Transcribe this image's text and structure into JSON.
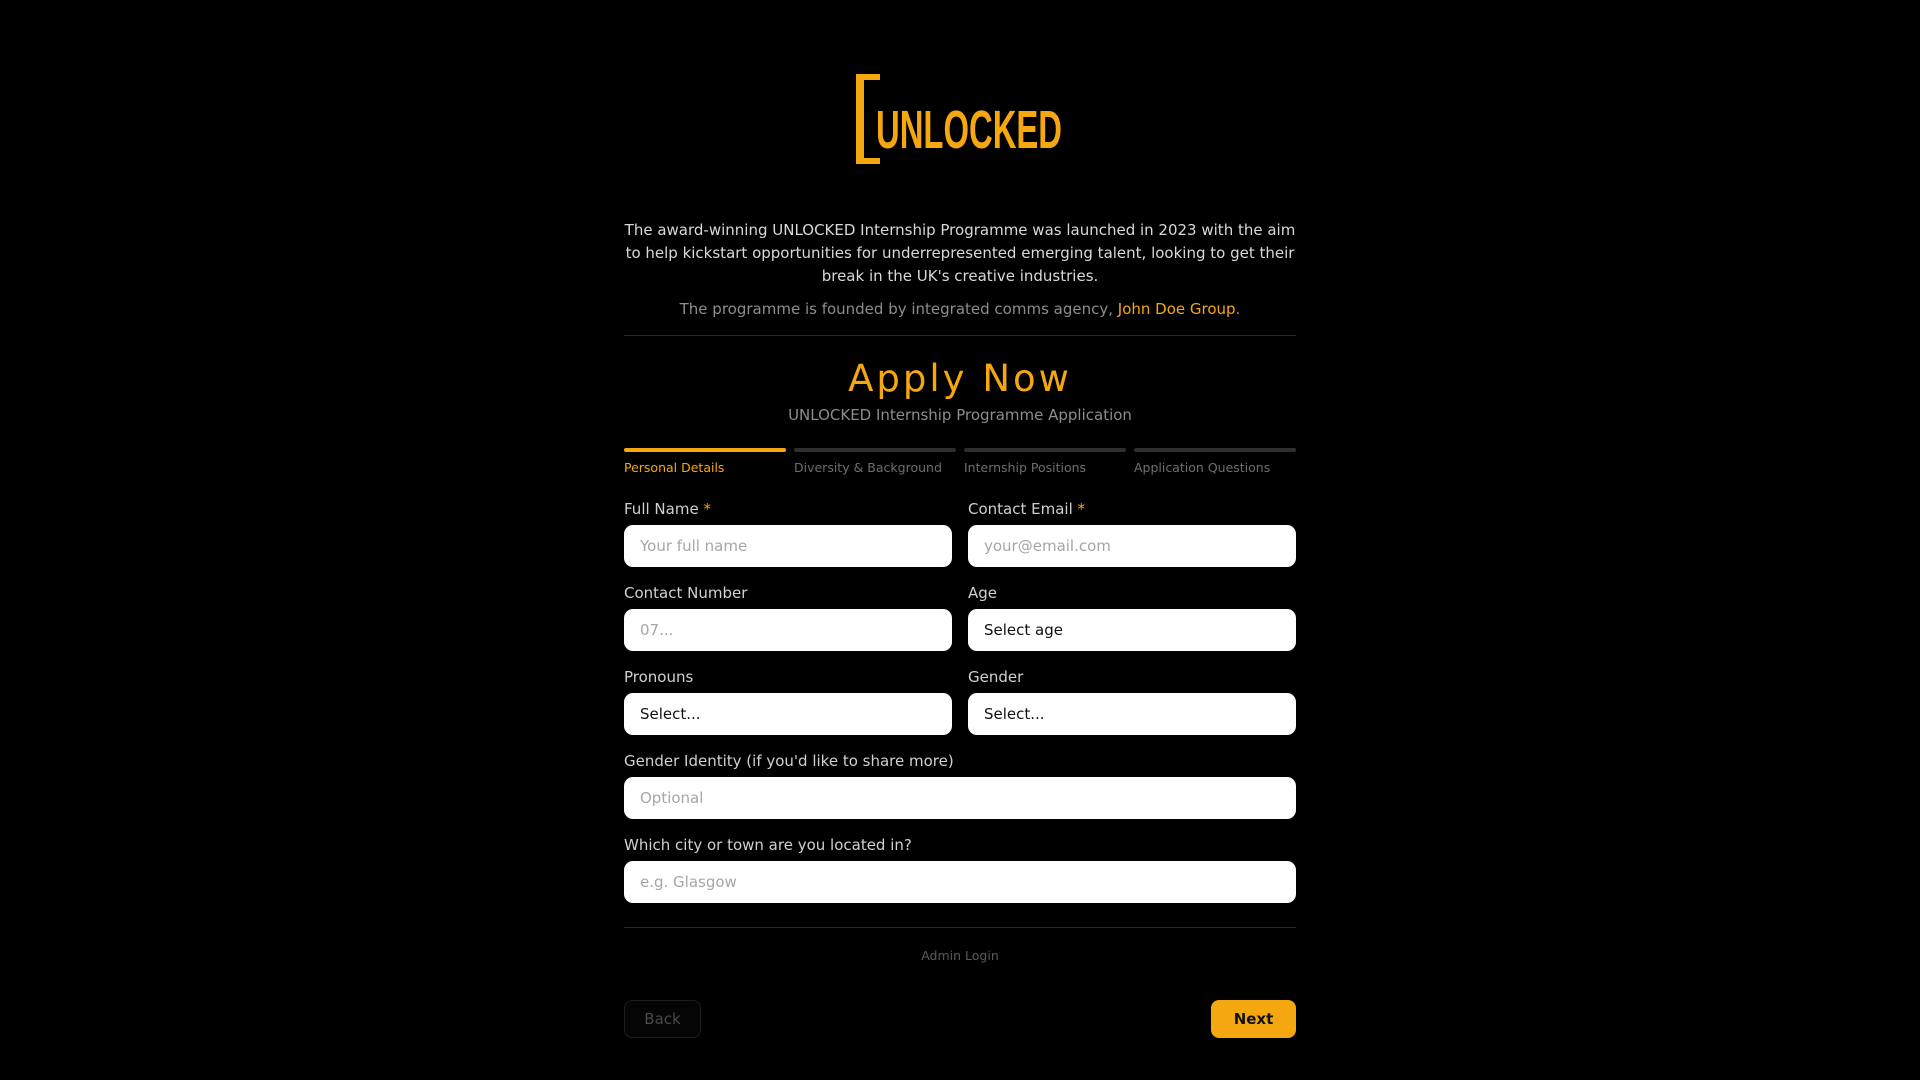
{
  "brand": {
    "logo_text": "UNLOCKED",
    "accent_color": "#f5a70f"
  },
  "intro": {
    "description": "The award-winning UNLOCKED Internship Programme was launched in 2023 with the aim to help kickstart opportunities for underrepresented emerging talent, looking to get their break in the UK's creative industries.",
    "founded_prefix": "The programme is founded by integrated comms agency, ",
    "founded_link": "John Doe Group",
    "founded_suffix": "."
  },
  "form": {
    "title": "Apply Now",
    "subtitle": "UNLOCKED Internship Programme Application",
    "steps": [
      {
        "label": "Personal Details",
        "active": true
      },
      {
        "label": "Diversity & Background",
        "active": false
      },
      {
        "label": "Internship Positions",
        "active": false
      },
      {
        "label": "Application Questions",
        "active": false
      }
    ],
    "fields": {
      "full_name": {
        "label": "Full Name",
        "required_mark": "*",
        "placeholder": "Your full name",
        "value": ""
      },
      "contact_email": {
        "label": "Contact Email",
        "required_mark": "*",
        "placeholder": "your@email.com",
        "value": ""
      },
      "contact_number": {
        "label": "Contact Number",
        "placeholder": "07...",
        "value": ""
      },
      "age": {
        "label": "Age",
        "selected": "Select age"
      },
      "pronouns": {
        "label": "Pronouns",
        "selected": "Select..."
      },
      "gender": {
        "label": "Gender",
        "selected": "Select..."
      },
      "gender_identity": {
        "label": "Gender Identity (if you'd like to share more)",
        "placeholder": "Optional",
        "value": ""
      },
      "city": {
        "label": "Which city or town are you located in?",
        "placeholder": "e.g. Glasgow",
        "value": ""
      }
    }
  },
  "footer": {
    "admin_login": "Admin Login",
    "back_label": "Back",
    "next_label": "Next"
  }
}
